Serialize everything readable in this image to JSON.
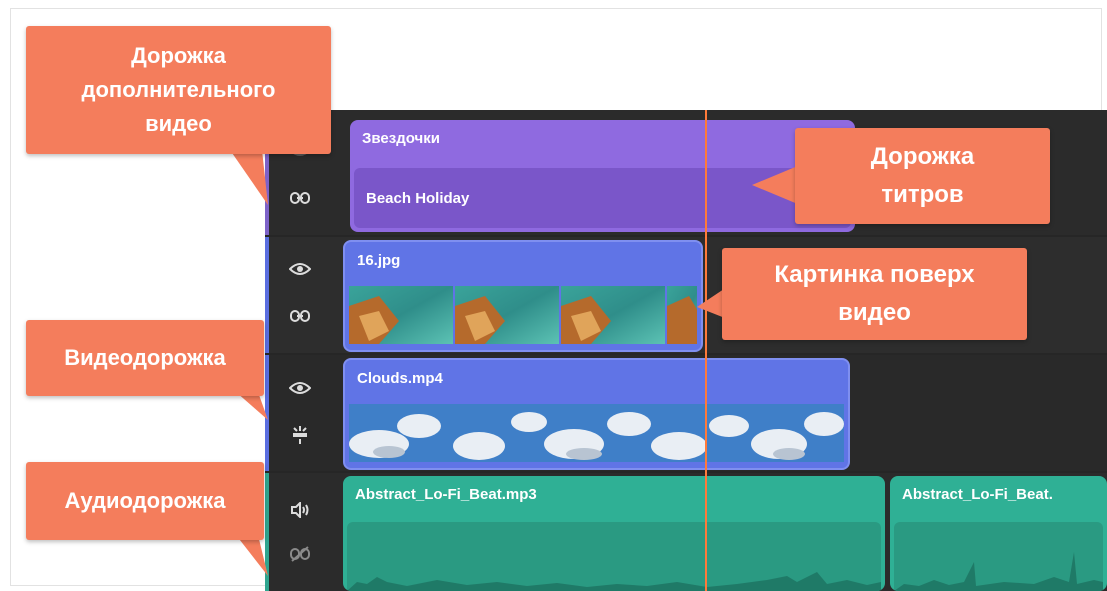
{
  "callouts": {
    "extra_video_track": "Дорожка\nдополнительного\nвидео",
    "titles_track": "Дорожка\nтитров",
    "image_over_video": "Картинка поверх\nвидео",
    "video_track": "Видеодорожка",
    "audio_track": "Аудиодорожка"
  },
  "clips": {
    "title_clip_name": "Звездочки",
    "title_inner_name": "Beach Holiday",
    "image_clip_name": "16.jpg",
    "video_clip_name": "Clouds.mp4",
    "audio_clip_1_name": "Abstract_Lo-Fi_Beat.mp3",
    "audio_clip_2_name": "Abstract_Lo-Fi_Beat."
  },
  "track_controls": {
    "track1": [
      "eye-icon",
      "link-icon"
    ],
    "track2": [
      "eye-icon",
      "link-icon"
    ],
    "track3": [
      "eye-icon",
      "transition-icon"
    ],
    "track4": [
      "volume-icon",
      "unlink-icon"
    ]
  },
  "colors": {
    "callout": "#f47d5c",
    "title_clip": "#8f6ae0",
    "video_clip": "#6074e6",
    "audio_clip": "#2fb095",
    "playhead": "#ff7a3a",
    "timeline_bg": "#262626"
  }
}
